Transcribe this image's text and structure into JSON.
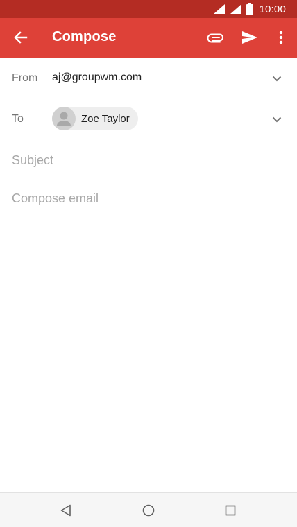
{
  "status_bar": {
    "time": "10:00",
    "icons": [
      "wifi-icon",
      "signal-icon",
      "battery-icon"
    ]
  },
  "app_bar": {
    "title": "Compose",
    "icons": [
      "back-arrow-icon",
      "paperclip-icon",
      "send-icon",
      "more-vertical-icon"
    ]
  },
  "compose": {
    "from_label": "From",
    "from_value": "aj@groupwm.com",
    "to_label": "To",
    "to_recipient": "Zoe Taylor",
    "subject_placeholder": "Subject",
    "body_placeholder": "Compose email"
  },
  "nav_bar": {
    "icons": [
      "nav-back-icon",
      "nav-home-icon",
      "nav-recents-icon"
    ]
  },
  "colors": {
    "status_bar": "#b42c23",
    "app_bar": "#de4138",
    "text_primary": "#212121",
    "text_secondary": "#757575",
    "placeholder": "#a8a8a8"
  }
}
